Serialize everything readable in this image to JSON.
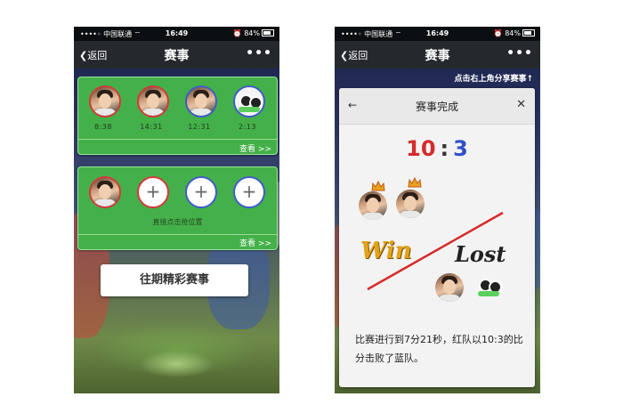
{
  "status": {
    "carrier": "中国联通",
    "time": "16:49",
    "battery": "84%"
  },
  "left": {
    "nav": {
      "back": "返回",
      "title": "赛事",
      "more": "•••"
    },
    "finished_card": {
      "players": [
        {
          "time": "8:38"
        },
        {
          "time": "14:31"
        },
        {
          "time": "12:31"
        },
        {
          "time": "2:13"
        }
      ],
      "view": "查看 >>"
    },
    "open_card": {
      "grab_hint": "直接点击抢位置",
      "plus": "+",
      "view": "查看 >>"
    },
    "history_button": "往期精彩赛事"
  },
  "right": {
    "nav": {
      "back": "返回",
      "title": "赛事",
      "more": "•••"
    },
    "share_hint": "点击右上角分享赛事↑",
    "modal": {
      "back": "←",
      "title": "赛事完成",
      "close": "✕",
      "score_red": "10",
      "score_sep": ":",
      "score_blue": "3",
      "win": "Win",
      "lost": "Lost",
      "summary": "比赛进行到7分21秒，红队以10:3的比分击败了蓝队。"
    }
  },
  "colors": {
    "card_green": "#44b049",
    "red_team": "#d62a2a",
    "blue_team": "#2f50c6",
    "win_gold": "#e3a21a"
  }
}
